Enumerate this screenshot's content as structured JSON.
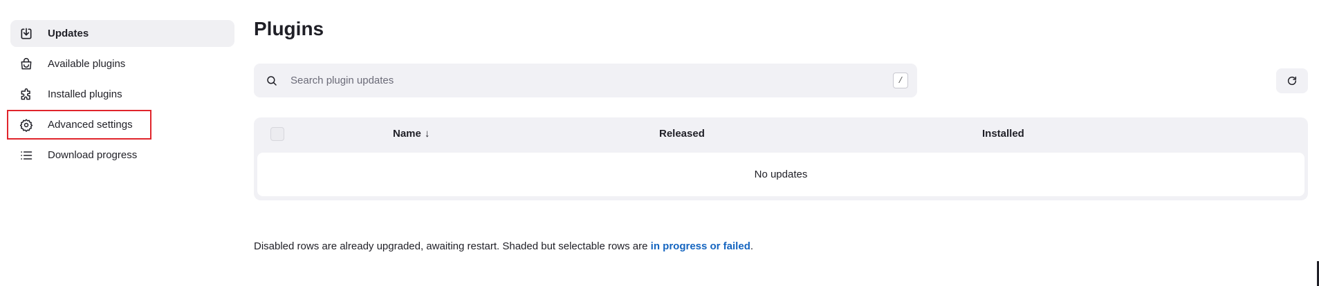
{
  "sidebar": {
    "items": [
      {
        "label": "Updates",
        "icon": "download-icon",
        "active": true
      },
      {
        "label": "Available plugins",
        "icon": "shopping-bag-icon",
        "active": false
      },
      {
        "label": "Installed plugins",
        "icon": "puzzle-icon",
        "active": false
      },
      {
        "label": "Advanced settings",
        "icon": "gear-icon",
        "active": false,
        "highlighted": true
      },
      {
        "label": "Download progress",
        "icon": "list-icon",
        "active": false
      }
    ]
  },
  "main": {
    "title": "Plugins",
    "search": {
      "placeholder": "Search plugin updates",
      "value": "",
      "shortcut": "/"
    },
    "refresh_icon": "refresh-icon",
    "table": {
      "columns": [
        "Name",
        "Released",
        "Installed"
      ],
      "sort_indicator": "↓",
      "empty_message": "No updates"
    },
    "footnote": {
      "text": "Disabled rows are already upgraded, awaiting restart. Shaded but selectable rows are ",
      "link_text": "in progress or failed",
      "suffix": "."
    }
  },
  "colors": {
    "highlight_outline": "#e0242b",
    "link": "#1565c0",
    "panel_background": "#f1f1f5"
  }
}
